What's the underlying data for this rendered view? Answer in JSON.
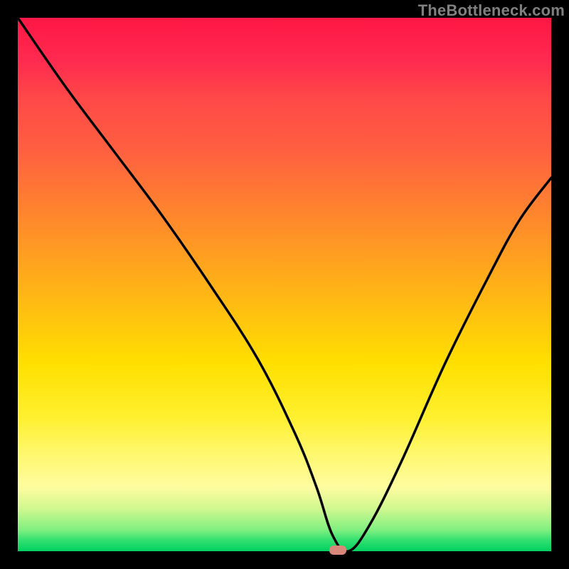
{
  "watermark": "TheBottleneck.com",
  "colors": {
    "background": "#000000",
    "curve": "#000000",
    "marker": "#d8877a",
    "watermark_text": "#808080"
  },
  "chart_data": {
    "type": "line",
    "title": "",
    "xlabel": "",
    "ylabel": "",
    "xlim": [
      0,
      100
    ],
    "ylim": [
      0,
      100
    ],
    "grid": false,
    "legend": false,
    "annotations": [
      {
        "type": "marker",
        "x": 60,
        "y": 0,
        "color": "#d8877a"
      }
    ],
    "series": [
      {
        "name": "bottleneck-curve",
        "x": [
          0,
          9,
          18,
          27,
          36,
          45,
          52,
          56,
          59,
          62,
          66,
          72,
          80,
          88,
          94,
          100
        ],
        "values": [
          100,
          87,
          75,
          63,
          50,
          36,
          22,
          12,
          3,
          0,
          5,
          17,
          35,
          51,
          62,
          70
        ]
      }
    ],
    "background_gradient": {
      "direction": "top-to-bottom",
      "stops": [
        {
          "pos": 0,
          "color": "#ff1744"
        },
        {
          "pos": 25,
          "color": "#ff6040"
        },
        {
          "pos": 50,
          "color": "#ffb010"
        },
        {
          "pos": 75,
          "color": "#fff030"
        },
        {
          "pos": 92,
          "color": "#d0f890"
        },
        {
          "pos": 100,
          "color": "#00d060"
        }
      ]
    }
  }
}
